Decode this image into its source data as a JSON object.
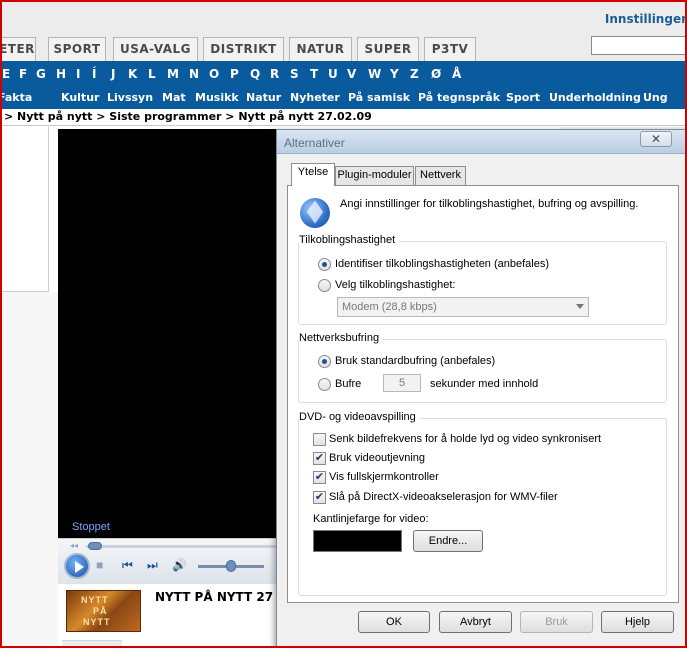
{
  "header": {
    "settings_link": "Innstillinger"
  },
  "tabs": [
    "ETER",
    "SPORT",
    "USA-VALG",
    "DISTRIKT",
    "NATUR",
    "SUPER",
    "P3TV"
  ],
  "alphabet": [
    "E",
    "F",
    "G",
    "H",
    "I",
    "Í",
    "J",
    "K",
    "L",
    "M",
    "N",
    "O",
    "P",
    "Q",
    "R",
    "S",
    "T",
    "U",
    "V",
    "W",
    "Y",
    "Z",
    "Ø",
    "Å"
  ],
  "categories": [
    "Fakta",
    "Kultur",
    "Livssyn",
    "Mat",
    "Musikk",
    "Natur",
    "Nyheter",
    "På samisk",
    "På tegnspråk",
    "Sport",
    "Underholdning",
    "Ung"
  ],
  "breadcrumb": "> Nytt på nytt > Siste programmer > Nytt på nytt 27.02.09",
  "player": {
    "status": "Stoppet"
  },
  "program": {
    "title": "NYTT PÅ NYTT 27",
    "thumb_lines": [
      "NYTT",
      "PÅ",
      "NYTT"
    ]
  },
  "dialog": {
    "title": "Alternativer",
    "close": "✕",
    "tabs": [
      "Ytelse",
      "Plugin-moduler",
      "Nettverk"
    ],
    "intro": "Angi innstillinger for tilkoblingshastighet, bufring og avspilling.",
    "connection": {
      "label": "Tilkoblingshastighet",
      "auto": "Identifiser tilkoblingshastigheten (anbefales)",
      "manual": "Velg tilkoblingshastighet:",
      "select_value": "Modem (28,8 kbps)"
    },
    "buffering": {
      "label": "Nettverksbufring",
      "default": "Bruk standardbufring (anbefales)",
      "custom": "Bufre",
      "seconds_value": "5",
      "seconds_label": "sekunder med innhold"
    },
    "dvd": {
      "label": "DVD- og videoavspilling",
      "options": [
        {
          "label": "Senk bildefrekvens for å holde lyd og video synkronisert",
          "checked": false
        },
        {
          "label": "Bruk videoutjevning",
          "checked": true
        },
        {
          "label": "Vis fullskjermkontroller",
          "checked": true
        },
        {
          "label": "Slå på DirectX-videoakselerasjon for WMV-filer",
          "checked": true
        }
      ],
      "border_color_label": "Kantlinjefarge for video:",
      "border_color": "#000000",
      "change_button": "Endre..."
    },
    "buttons": {
      "ok": "OK",
      "cancel": "Avbryt",
      "apply": "Bruk",
      "help": "Hjelp"
    }
  }
}
